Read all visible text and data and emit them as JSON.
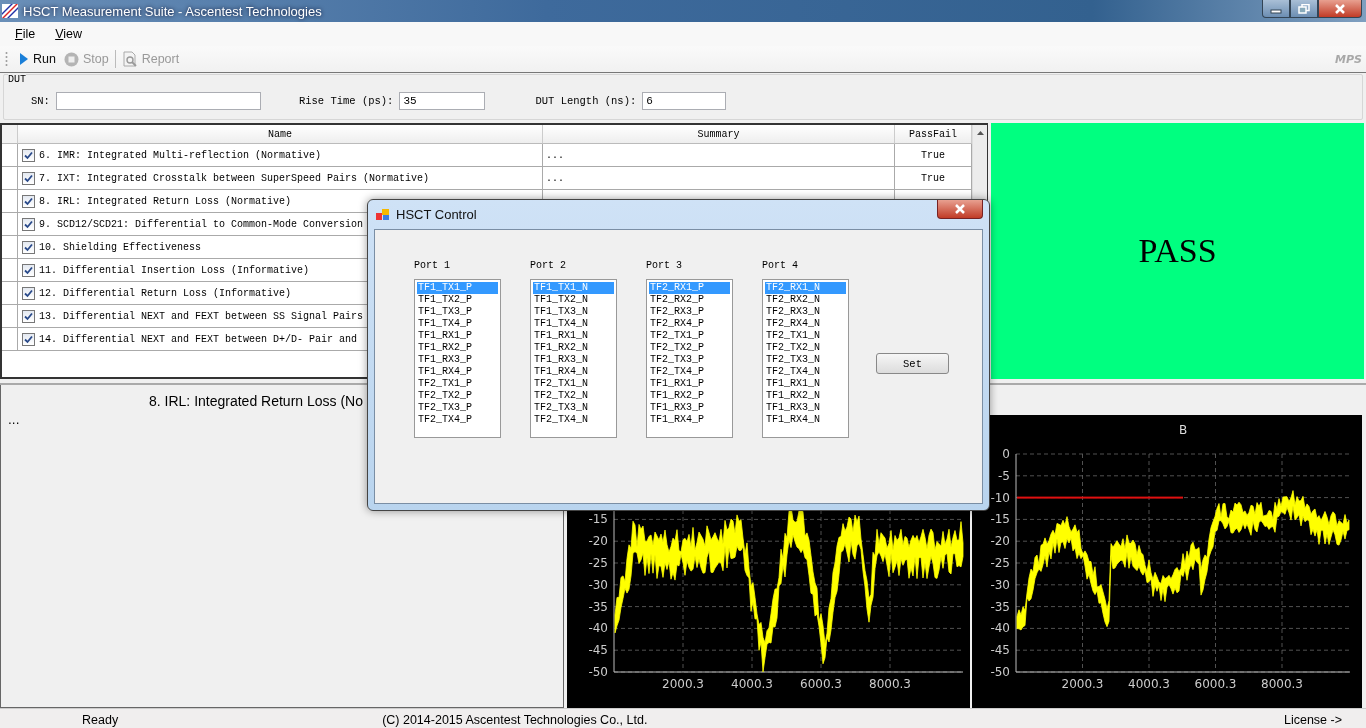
{
  "window": {
    "title": "HSCT Measurement Suite - Ascentest Technologies"
  },
  "menu": [
    {
      "label": "File"
    },
    {
      "label": "View"
    }
  ],
  "toolbar": {
    "buttons": [
      {
        "label": "Run",
        "kind": "run",
        "disabled": false
      },
      {
        "label": "Stop",
        "kind": "stop",
        "disabled": true
      },
      {
        "label": "Report",
        "kind": "report",
        "disabled": true
      }
    ],
    "brand": "MPS"
  },
  "dut": {
    "title": "DUT",
    "fields": [
      {
        "label": "SN:"
      },
      {
        "label": "Rise Time (ps):",
        "value": "35"
      },
      {
        "label": "DUT Length (ns):",
        "value": "6"
      }
    ]
  },
  "table": {
    "columns": [
      "Name",
      "Summary",
      "PassFail"
    ],
    "rows": [
      {
        "checked": true,
        "name": "6. IMR: Integrated Multi-reflection (Normative)",
        "summary": "...",
        "passfail": "True"
      },
      {
        "checked": true,
        "name": "7. IXT: Integrated Crosstalk between SuperSpeed Pairs (Normative)",
        "summary": "...",
        "passfail": "True"
      },
      {
        "checked": true,
        "name": "8. IRL: Integrated Return Loss (Normative)"
      },
      {
        "checked": true,
        "name": "9. SCD12/SCD21: Differential to Common-Mode Conversion"
      },
      {
        "checked": true,
        "name": "10. Shielding Effectiveness"
      },
      {
        "checked": true,
        "name": "11. Differential Insertion Loss (Informative)"
      },
      {
        "checked": true,
        "name": "12. Differential Return Loss (Informative)"
      },
      {
        "checked": true,
        "name": "13. Differential NEXT and FEXT between SS Signal Pairs"
      },
      {
        "checked": true,
        "name": "14. Differential NEXT and FEXT between D+/D- Pair and"
      }
    ]
  },
  "result": {
    "text": "PASS",
    "passed": true
  },
  "detail": {
    "title": "8. IRL: Integrated Return Loss (No",
    "body": "..."
  },
  "charts": [
    {
      "kind": "dips",
      "y_labels": [
        "-15",
        "-20",
        "-25",
        "-30",
        "-35",
        "-40",
        "-45",
        "-50"
      ],
      "x_labels": [
        "2000.3",
        "4000.3",
        "6000.3",
        "8000.3"
      ]
    },
    {
      "kind": "rising",
      "title": "B",
      "y_labels": [
        "0",
        "-5",
        "-10",
        "-15",
        "-20",
        "-25",
        "-30",
        "-35",
        "-40",
        "-45",
        "-50"
      ],
      "x_labels": [
        "2000.3",
        "4000.3",
        "6000.3",
        "8000.3"
      ],
      "limit_line": true
    }
  ],
  "dialog": {
    "title": "HSCT Control",
    "button": "Set",
    "ports": [
      {
        "label": "Port 1",
        "items": [
          {
            "text": "TF1_TX1_P",
            "selected": true
          },
          {
            "text": "TF1_TX2_P",
            "selected": false
          },
          {
            "text": "TF1_TX3_P",
            "selected": false
          },
          {
            "text": "TF1_TX4_P",
            "selected": false
          },
          {
            "text": "TF1_RX1_P",
            "selected": false
          },
          {
            "text": "TF1_RX2_P",
            "selected": false
          },
          {
            "text": "TF1_RX3_P",
            "selected": false
          },
          {
            "text": "TF1_RX4_P",
            "selected": false
          },
          {
            "text": "TF2_TX1_P",
            "selected": false
          },
          {
            "text": "TF2_TX2_P",
            "selected": false
          },
          {
            "text": "TF2_TX3_P",
            "selected": false
          },
          {
            "text": "TF2_TX4_P",
            "selected": false
          }
        ]
      },
      {
        "label": "Port 2",
        "items": [
          {
            "text": "TF1_TX1_N",
            "selected": true
          },
          {
            "text": "TF1_TX2_N",
            "selected": false
          },
          {
            "text": "TF1_TX3_N",
            "selected": false
          },
          {
            "text": "TF1_TX4_N",
            "selected": false
          },
          {
            "text": "TF1_RX1_N",
            "selected": false
          },
          {
            "text": "TF1_RX2_N",
            "selected": false
          },
          {
            "text": "TF1_RX3_N",
            "selected": false
          },
          {
            "text": "TF1_RX4_N",
            "selected": false
          },
          {
            "text": "TF2_TX1_N",
            "selected": false
          },
          {
            "text": "TF2_TX2_N",
            "selected": false
          },
          {
            "text": "TF2_TX3_N",
            "selected": false
          },
          {
            "text": "TF2_TX4_N",
            "selected": false
          }
        ]
      },
      {
        "label": "Port 3",
        "items": [
          {
            "text": "TF2_RX1_P",
            "selected": true
          },
          {
            "text": "TF2_RX2_P",
            "selected": false
          },
          {
            "text": "TF2_RX3_P",
            "selected": false
          },
          {
            "text": "TF2_RX4_P",
            "selected": false
          },
          {
            "text": "TF2_TX1_P",
            "selected": false
          },
          {
            "text": "TF2_TX2_P",
            "selected": false
          },
          {
            "text": "TF2_TX3_P",
            "selected": false
          },
          {
            "text": "TF2_TX4_P",
            "selected": false
          },
          {
            "text": "TF1_RX1_P",
            "selected": false
          },
          {
            "text": "TF1_RX2_P",
            "selected": false
          },
          {
            "text": "TF1_RX3_P",
            "selected": false
          },
          {
            "text": "TF1_RX4_P",
            "selected": false
          }
        ]
      },
      {
        "label": "Port 4",
        "items": [
          {
            "text": "TF2_RX1_N",
            "selected": true
          },
          {
            "text": "TF2_RX2_N",
            "selected": false
          },
          {
            "text": "TF2_RX3_N",
            "selected": false
          },
          {
            "text": "TF2_RX4_N",
            "selected": false
          },
          {
            "text": "TF2_TX1_N",
            "selected": false
          },
          {
            "text": "TF2_TX2_N",
            "selected": false
          },
          {
            "text": "TF2_TX3_N",
            "selected": false
          },
          {
            "text": "TF2_TX4_N",
            "selected": false
          },
          {
            "text": "TF1_RX1_N",
            "selected": false
          },
          {
            "text": "TF1_RX2_N",
            "selected": false
          },
          {
            "text": "TF1_RX3_N",
            "selected": false
          },
          {
            "text": "TF1_RX4_N",
            "selected": false
          }
        ]
      }
    ]
  },
  "status_bar": {
    "status": "Ready",
    "copyright": "(C) 2014-2015 Ascentest Technologies Co., Ltd.",
    "license": "License ->"
  }
}
